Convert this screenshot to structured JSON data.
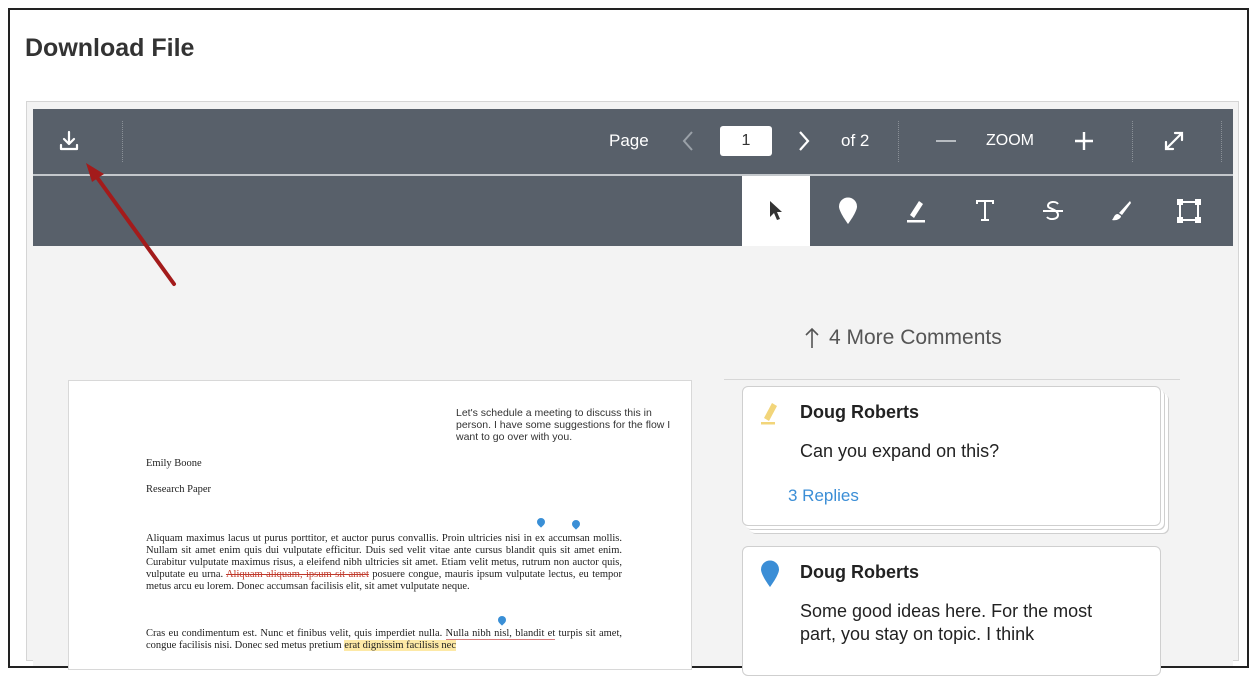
{
  "page": {
    "title": "Download File"
  },
  "toolbar": {
    "page_label": "Page",
    "current_page": "1",
    "of_label": "of 2",
    "zoom_label": "ZOOM"
  },
  "icons": {
    "download": "download-icon",
    "prev": "chevron-left-icon",
    "next": "chevron-right-icon",
    "zoom_out": "minus-icon",
    "zoom_in": "plus-icon",
    "fullscreen": "expand-icon",
    "tools": [
      "select-cursor-icon",
      "point-annotation-icon",
      "highlight-icon",
      "text-icon",
      "strikethrough-icon",
      "freehand-draw-icon",
      "area-select-icon"
    ]
  },
  "comments_panel": {
    "more_label": "4 More Comments",
    "cards": [
      {
        "author": "Doug Roberts",
        "text": "Can you expand on this?",
        "replies": "3 Replies",
        "icon": "highlight-icon"
      },
      {
        "author": "Doug Roberts",
        "text_lines": [
          "Some good ideas here. For the most",
          "part, you stay on topic. I think"
        ],
        "icon": "pin-icon"
      }
    ]
  },
  "document": {
    "note": "Let's schedule a meeting to discuss this in person. I have some suggestions for the flow I want to go over with you.",
    "author": "Emily Boone",
    "subtitle": "Research Paper",
    "para1_a": "Aliquam maximus lacus ut purus porttitor, et auctor purus convallis. Proin ultricies nisi in ex accumsan mollis. Nullam sit amet enim quis dui vulputate efficitur. Duis sed velit vitae ante cursus blandit quis sit amet enim. Curabitur vulputate maximus risus, a eleifend nibh ultricies sit amet. Etiam velit metus, rutrum non auctor quis, vulputate eu urna. ",
    "para1_strike": "Aliquam aliquam, ipsum sit amet",
    "para1_b": " posuere congue, mauris ipsum vulputate lectus, eu tempor metus arcu eu lorem. Donec accumsan facilisis elit, sit amet vulputate neque.",
    "para2_a": "Cras eu condimentum est. Nunc et finibus velit, quis imperdiet nulla. ",
    "para2_underline": "Nulla nibh nisl, blandit et",
    "para2_b": " turpis sit amet, congue facilisis nisi. Donec sed metus pretium ",
    "para2_yellow": "erat dignissim facilisis nec"
  },
  "colors": {
    "toolbar_bg": "#58606a",
    "accent_blue": "#3b8ed6",
    "highlight_yellow": "#f2d57a",
    "annotation_arrow": "#a31b1b"
  }
}
